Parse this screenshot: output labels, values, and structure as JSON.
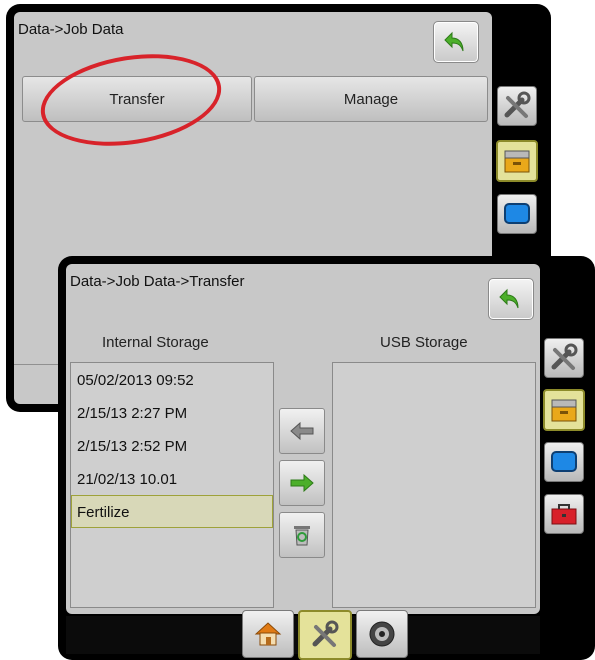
{
  "back_screen": {
    "title": "Data->Job Data",
    "tabs": [
      {
        "label": "Transfer"
      },
      {
        "label": "Manage"
      }
    ],
    "sidebar_icons": [
      "tools-icon",
      "storage-icon",
      "display-icon"
    ],
    "selected_sidebar": "storage-icon"
  },
  "front_screen": {
    "title": "Data->Job Data->Transfer",
    "internal_label": "Internal Storage",
    "usb_label": "USB Storage",
    "internal_items": [
      {
        "label": "05/02/2013 09:52"
      },
      {
        "label": "2/15/13 2:27 PM"
      },
      {
        "label": "2/15/13 2:52 PM"
      },
      {
        "label": "21/02/13 10.01"
      },
      {
        "label": "Fertilize"
      }
    ],
    "selected_item": "Fertilize",
    "usb_items": [],
    "transfer_buttons": [
      "arrow-left-icon",
      "arrow-right-icon",
      "recycle-icon"
    ],
    "sidebar_icons": [
      "tools-icon",
      "storage-icon",
      "display-icon",
      "toolbox-icon"
    ],
    "selected_sidebar": "storage-icon",
    "bottom_nav": [
      "home-icon",
      "tools-icon",
      "gauge-icon"
    ],
    "selected_nav": "tools-icon"
  },
  "colors": {
    "panel_bg": "#c8c8c8",
    "bezel": "#000000",
    "selection_highlight": "#e4e29a",
    "annotation_red": "#d8232a",
    "back_arrow_green": "#4caf2a"
  }
}
